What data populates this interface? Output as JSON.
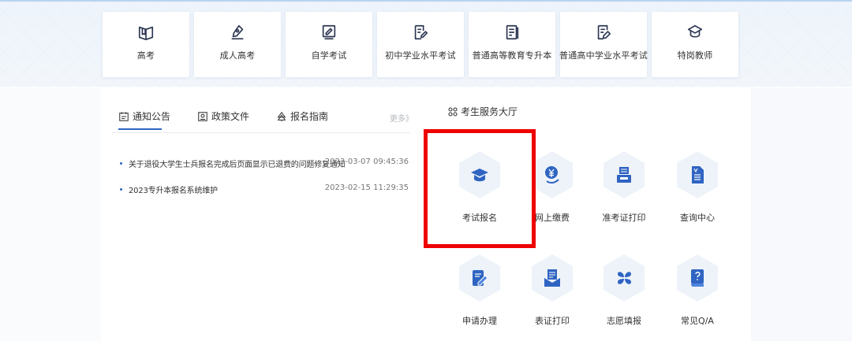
{
  "categories": [
    {
      "label": "高考",
      "icon": "book-icon"
    },
    {
      "label": "成人高考",
      "icon": "pen-nib-icon"
    },
    {
      "label": "自学考试",
      "icon": "tablet-edit-icon"
    },
    {
      "label": "初中学业水平考试",
      "icon": "doc-pen-icon"
    },
    {
      "label": "普通高等教育专升本",
      "icon": "doc-lines-icon"
    },
    {
      "label": "普通高中学业水平考试",
      "icon": "doc-edit-icon"
    },
    {
      "label": "特岗教师",
      "icon": "graduation-cap-icon"
    }
  ],
  "notice": {
    "tabs": [
      {
        "label": "通知公告",
        "icon": "notice-board-icon"
      },
      {
        "label": "政策文件",
        "icon": "policy-doc-icon"
      },
      {
        "label": "报名指南",
        "icon": "guide-tree-icon"
      }
    ],
    "more": "更多》",
    "items": [
      {
        "title": "关于退役大学生士兵报名完成后页面显示已退费的问题修复通知",
        "time": "2023-03-07 09:45:36"
      },
      {
        "title": "2023专升本报名系统维护",
        "time": "2023-02-15 11:29:35"
      }
    ]
  },
  "hall": {
    "title": "考生服务大厅",
    "services": [
      {
        "label": "考试报名",
        "icon": "graduation-cap-icon"
      },
      {
        "label": "网上缴费",
        "icon": "yuan-coin-icon"
      },
      {
        "label": "准考证打印",
        "icon": "printer-icon"
      },
      {
        "label": "查询中心",
        "icon": "search-doc-icon"
      },
      {
        "label": "申请办理",
        "icon": "apply-pen-icon"
      },
      {
        "label": "表证打印",
        "icon": "form-print-icon"
      },
      {
        "label": "志愿填报",
        "icon": "clover-icon"
      },
      {
        "label": "常见Q/A",
        "icon": "help-book-icon"
      }
    ]
  },
  "colors": {
    "accent": "#2f64c2",
    "icon_blue": "#2f64c2",
    "hex_bg": "#eef3fa",
    "highlight": "#ee0000"
  }
}
